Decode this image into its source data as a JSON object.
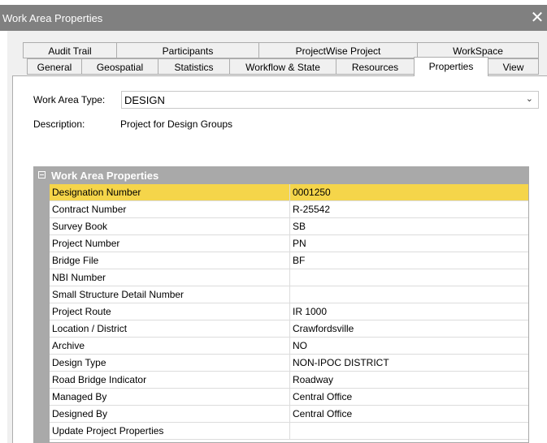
{
  "window": {
    "title": "Work Area Properties",
    "close_glyph": "✕"
  },
  "tabs": {
    "top": [
      "Audit Trail",
      "Participants",
      "ProjectWise Project",
      "WorkSpace"
    ],
    "bottom": [
      "General",
      "Geospatial",
      "Statistics",
      "Workflow & State",
      "Resources",
      "Properties",
      "View"
    ],
    "active": "Properties"
  },
  "form": {
    "type_label": "Work Area Type:",
    "type_value": "DESIGN",
    "description_label": "Description:",
    "description_value": "Project for Design Groups"
  },
  "grid": {
    "header": "Work Area Properties",
    "rows": [
      {
        "name": "Designation Number",
        "value": "0001250",
        "selected": true
      },
      {
        "name": "Contract Number",
        "value": "R-25542"
      },
      {
        "name": "Survey Book",
        "value": "SB"
      },
      {
        "name": "Project Number",
        "value": "PN"
      },
      {
        "name": "Bridge File",
        "value": "BF"
      },
      {
        "name": "NBI Number",
        "value": ""
      },
      {
        "name": "Small Structure Detail Number",
        "value": ""
      },
      {
        "name": "Project Route",
        "value": "IR 1000"
      },
      {
        "name": "Location / District",
        "value": "Crawfordsville"
      },
      {
        "name": "Archive",
        "value": "NO"
      },
      {
        "name": "Design Type",
        "value": "NON-IPOC DISTRICT"
      },
      {
        "name": "Road Bridge Indicator",
        "value": "Roadway"
      },
      {
        "name": "Managed By",
        "value": "Central Office"
      },
      {
        "name": "Designed By",
        "value": "Central Office"
      },
      {
        "name": "Update Project Properties",
        "value": ""
      }
    ]
  },
  "colors": {
    "titlebar": "#808080",
    "dialog_bg": "#f0f0f0",
    "grid_header": "#a9a9a9",
    "selected_row": "#f5d54a"
  }
}
